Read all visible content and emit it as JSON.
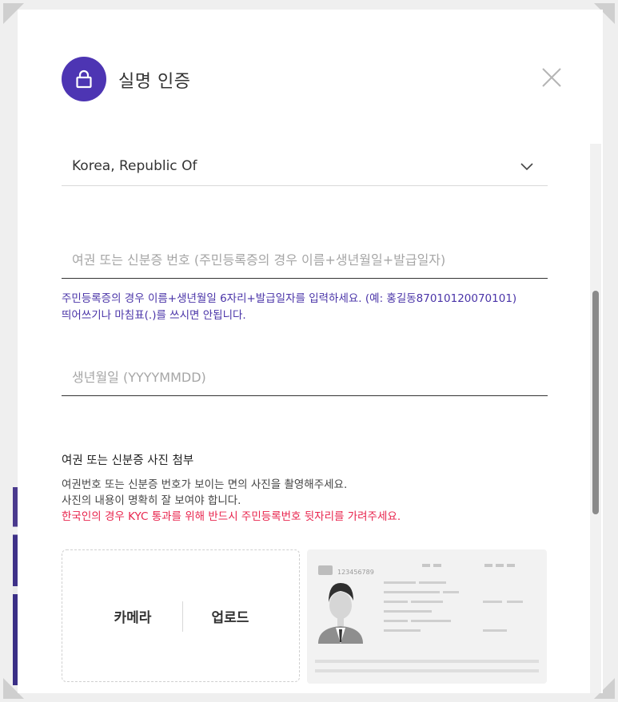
{
  "modal": {
    "title": "실명 인증",
    "icon": "lock-icon",
    "close_icon": "close-icon",
    "accent_color": "#4d35b3"
  },
  "country_select": {
    "value": "Korea, Republic Of",
    "icon": "chevron-down-icon"
  },
  "passport_field": {
    "placeholder": "여권 또는 신분증 번호 (주민등록증의 경우 이름+생년월일+발급일자)",
    "value": ""
  },
  "id_hint": {
    "line1": "주민등록증의 경우 이름+생년월일 6자리+발급일자를 입력하세요. (예: 홍길동8701012007010​1)",
    "line2": "띄어쓰기나 마침표(.)를 쓰시면 안됩니다.",
    "color": "#4a34a8"
  },
  "birth_field": {
    "placeholder": "생년월일 (YYYYMMDD)",
    "value": ""
  },
  "attach": {
    "title": "여권 또는 신분증 사진 첨부",
    "desc_line1": "여권번호 또는 신분증 번호가 보이는 면의 사진을 촬영해주세요.",
    "desc_line2": "사진의 내용이 명확히 잘 보여야 합니다.",
    "warning": "한국인의 경우 KYC 통과를 위해 반드시 주민등록번호 뒷자리를 가려주세요.",
    "warning_color": "#e8244d",
    "camera_label": "카메라",
    "upload_label": "업로드"
  },
  "id_sample": {
    "number": "123456789",
    "icon": "id-card-sample-icon"
  }
}
